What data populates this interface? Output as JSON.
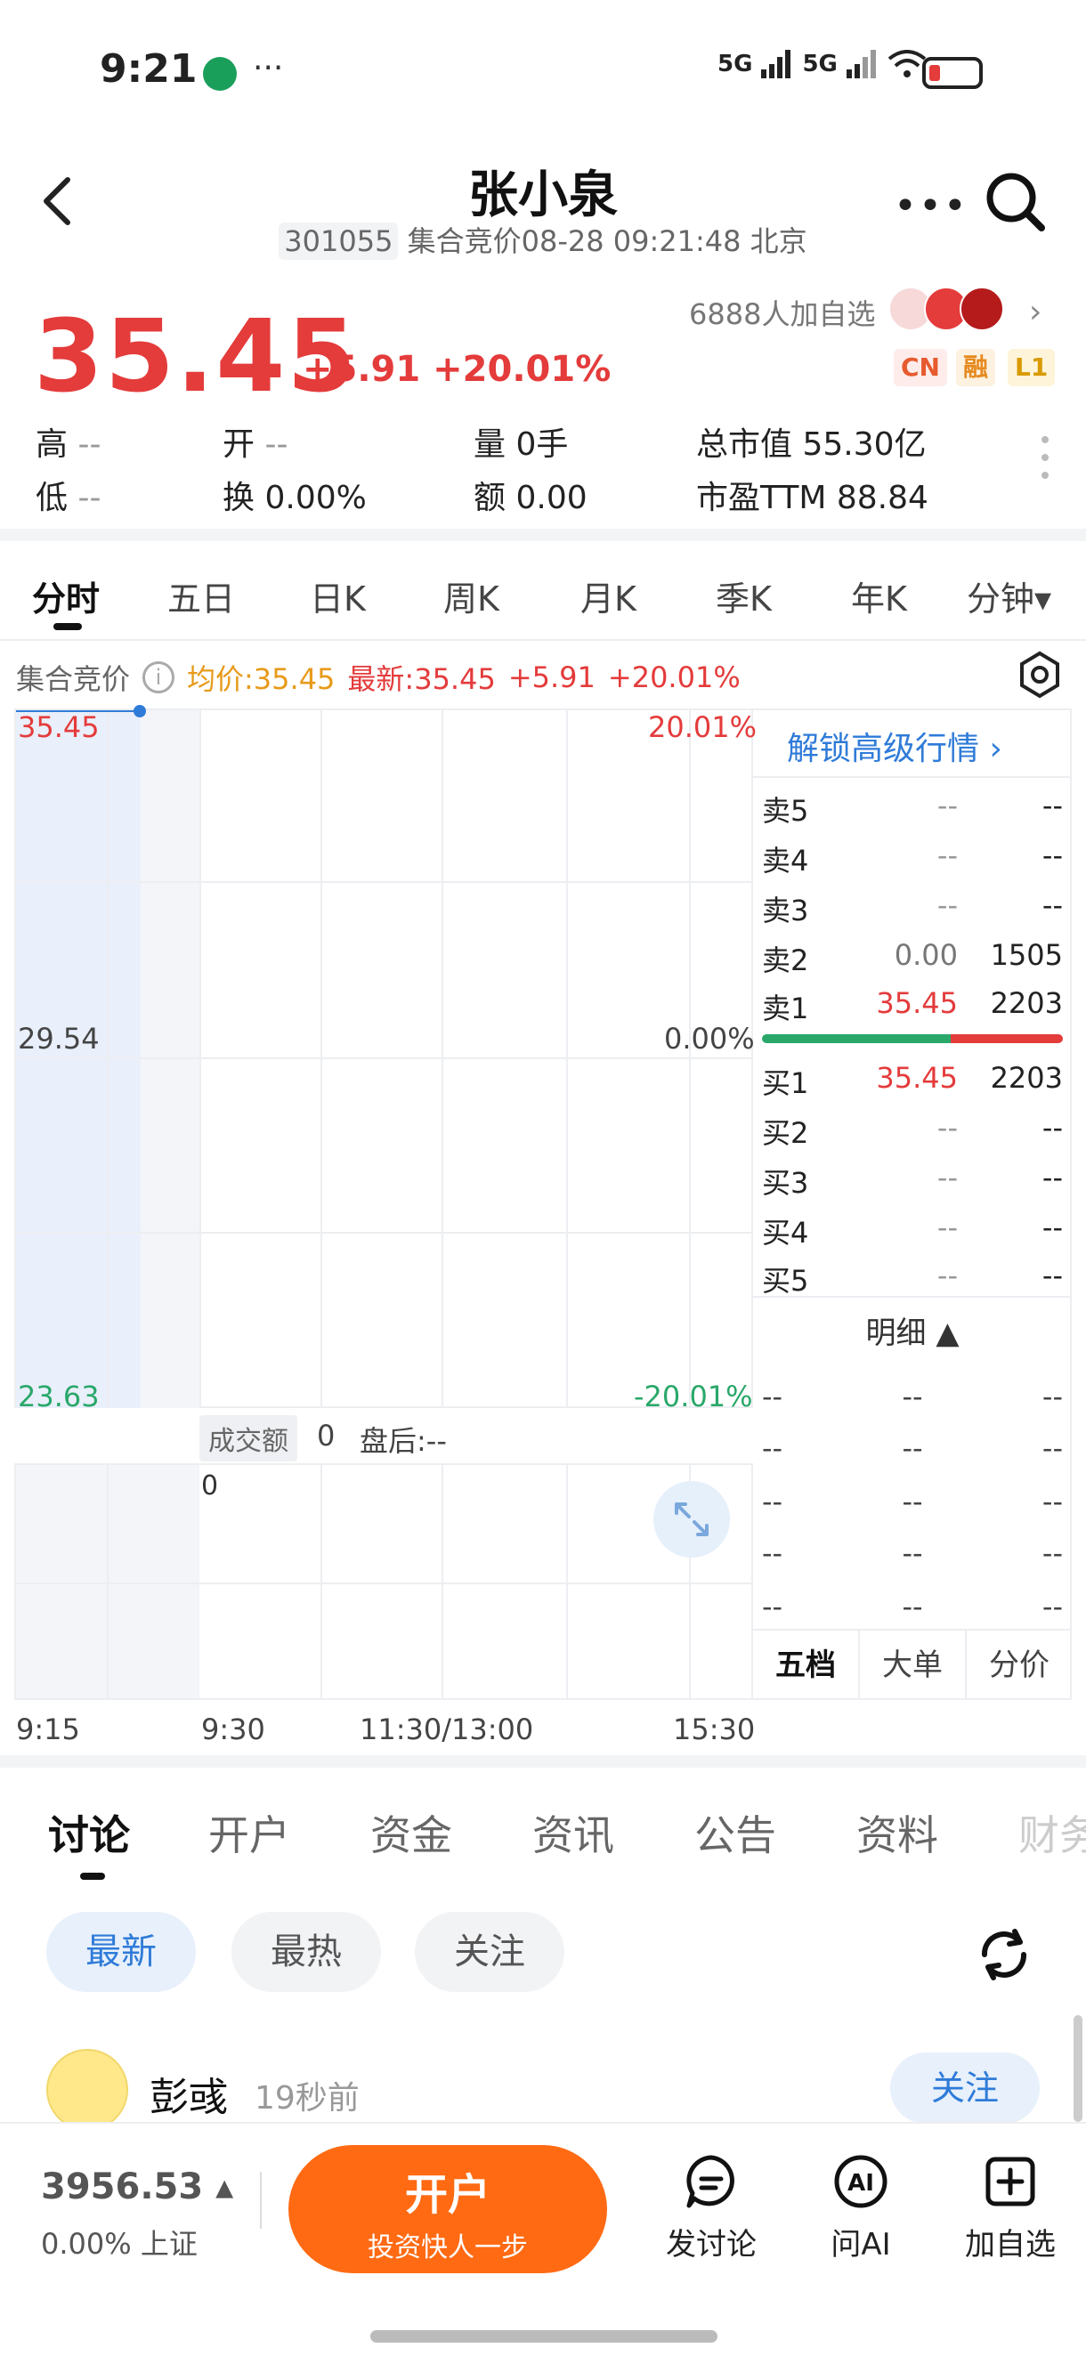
{
  "status_bar": {
    "time": "9:21",
    "dots": "···",
    "sig1": "5G",
    "sig2": "5G"
  },
  "header": {
    "title": "张小泉",
    "code": "301055",
    "subtitle": "集合竞价08-28 09:21:48 北京"
  },
  "quote": {
    "price": "35.45",
    "change": "+5.91",
    "change_pct": "+20.01%",
    "watch_count": "6888人加自选",
    "tags": [
      "CN",
      "融",
      "L1"
    ],
    "high_label": "高",
    "high": "--",
    "open_label": "开",
    "open": "--",
    "volume_label": "量",
    "volume": "0手",
    "mktcap_label": "总市值",
    "mktcap": "55.30亿",
    "low_label": "低",
    "low": "--",
    "turnover_label": "换",
    "turnover": "0.00%",
    "amount_label": "额",
    "amount": "0.00",
    "pe_label": "市盈TTM",
    "pe": "88.84"
  },
  "period_tabs": [
    "分时",
    "五日",
    "日K",
    "周K",
    "月K",
    "季K",
    "年K",
    "分钟▾"
  ],
  "chart": {
    "mode_label": "集合竞价",
    "avg": "均价:35.45",
    "latest": "最新:35.45",
    "change": "+5.91",
    "change_pct": "+20.01%",
    "y_top": "35.45",
    "y_mid": "29.54",
    "y_bot": "23.63",
    "pct_top": "20.01%",
    "pct_mid": "0.00%",
    "pct_bot": "-20.01%",
    "volume_label": "成交额",
    "volume_value": "0",
    "after_hours": "盘后:--",
    "volume_axis": "0",
    "times": [
      "9:15",
      "9:30",
      "11:30/13:00",
      "15:30"
    ]
  },
  "orderbook": {
    "unlock": "解锁高级行情 ›",
    "asks": [
      {
        "label": "卖5",
        "price": "--",
        "vol": "--"
      },
      {
        "label": "卖4",
        "price": "--",
        "vol": "--"
      },
      {
        "label": "卖3",
        "price": "--",
        "vol": "--"
      },
      {
        "label": "卖2",
        "price": "0.00",
        "vol": "1505"
      },
      {
        "label": "卖1",
        "price": "35.45",
        "vol": "2203"
      }
    ],
    "bids": [
      {
        "label": "买1",
        "price": "35.45",
        "vol": "2203"
      },
      {
        "label": "买2",
        "price": "--",
        "vol": "--"
      },
      {
        "label": "买3",
        "price": "--",
        "vol": "--"
      },
      {
        "label": "买4",
        "price": "--",
        "vol": "--"
      },
      {
        "label": "买5",
        "price": "--",
        "vol": "--"
      }
    ],
    "detail_header": "明细 ▲",
    "details": [
      [
        "--",
        "--",
        "--"
      ],
      [
        "--",
        "--",
        "--"
      ],
      [
        "--",
        "--",
        "--"
      ],
      [
        "--",
        "--",
        "--"
      ],
      [
        "--",
        "--",
        "--"
      ]
    ],
    "tabs": [
      "五档",
      "大单",
      "分价"
    ]
  },
  "bottom_tabs": [
    "讨论",
    "开户",
    "资金",
    "资讯",
    "公告",
    "资料",
    "财务"
  ],
  "filters": [
    "最新",
    "最热",
    "关注"
  ],
  "post": {
    "author": "彭彧",
    "time_ago": "19秒前",
    "follow": "关注"
  },
  "bottom_bar": {
    "index_value": "3956.53 ▴",
    "index_sub": "0.00% 上证",
    "open_title": "开户",
    "open_sub": "投资快人一步",
    "actions": [
      "发讨论",
      "问AI",
      "加自选"
    ]
  },
  "colors": {
    "up": "#e43b3b",
    "down": "#2aa86a",
    "accent": "#2f7bd8",
    "cta": "#ff6a13"
  }
}
